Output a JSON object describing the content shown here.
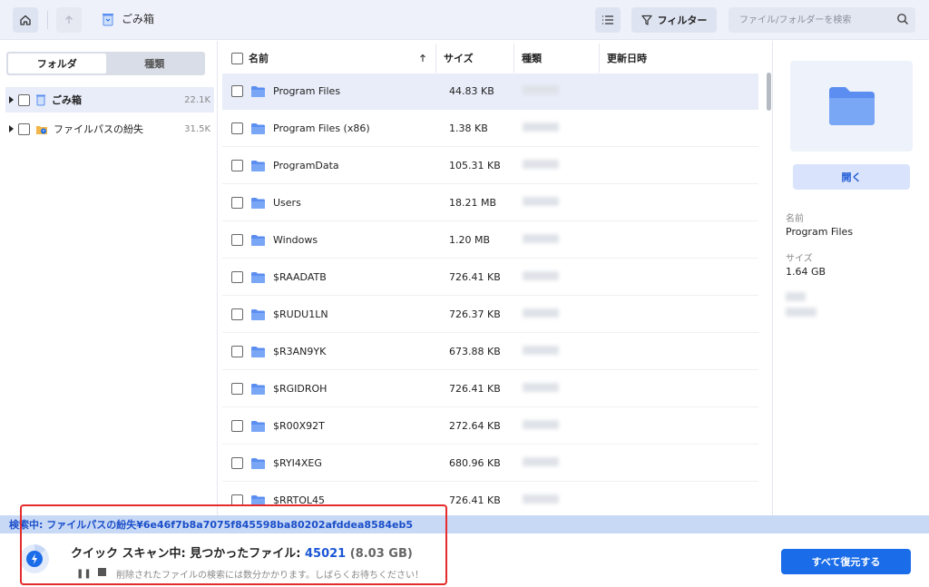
{
  "colors": {
    "accent": "#1a6ce8",
    "folder": "#5b8ef0",
    "highlight": "#e52b2b",
    "status_bg": "#c8d9f6"
  },
  "toolbar": {
    "home_icon": "home-icon",
    "up_icon": "arrow-up-icon",
    "breadcrumb": "ごみ箱",
    "filter_label": "フィルター",
    "search_placeholder": "ファイル/フォルダーを検索"
  },
  "sidebar": {
    "tabs": [
      "フォルダ",
      "種類"
    ],
    "active_tab": 0,
    "tree": [
      {
        "name": "ごみ箱",
        "count": "22.1K",
        "selected": true
      },
      {
        "name": "ファイルパスの紛失",
        "count": "31.5K",
        "selected": false
      }
    ]
  },
  "list": {
    "columns": {
      "name": "名前",
      "size": "サイズ",
      "type": "種類",
      "modified": "更新日時"
    },
    "rows": [
      {
        "name": "Program Files",
        "size": "44.83 KB",
        "selected": true
      },
      {
        "name": "Program Files (x86)",
        "size": "1.38 KB"
      },
      {
        "name": "ProgramData",
        "size": "105.31 KB"
      },
      {
        "name": "Users",
        "size": "18.21 MB"
      },
      {
        "name": "Windows",
        "size": "1.20 MB"
      },
      {
        "name": "$RAADATB",
        "size": "726.41 KB"
      },
      {
        "name": "$RUDU1LN",
        "size": "726.37 KB"
      },
      {
        "name": "$R3AN9YK",
        "size": "673.88 KB"
      },
      {
        "name": "$RGIDROH",
        "size": "726.41 KB"
      },
      {
        "name": "$R00X92T",
        "size": "272.64 KB"
      },
      {
        "name": "$RYI4XEG",
        "size": "680.96 KB"
      },
      {
        "name": "$RRTOL45",
        "size": "726.41 KB"
      }
    ]
  },
  "details": {
    "open_label": "開く",
    "name_label": "名前",
    "name_value": "Program Files",
    "size_label": "サイズ",
    "size_value": "1.64 GB"
  },
  "status": {
    "path_text": "検索中: ファイルパスの紛失¥6e46f7b8a7075f845598ba80202afddea8584eb5",
    "scan_prefix": "クイック スキャン中: 見つかったファイル: ",
    "found_count": "45021",
    "found_size": "(8.03 GB)",
    "note": "削除されたファイルの検索には数分かかります。しばらくお待ちください！",
    "recover_all": "すべて復元する"
  }
}
